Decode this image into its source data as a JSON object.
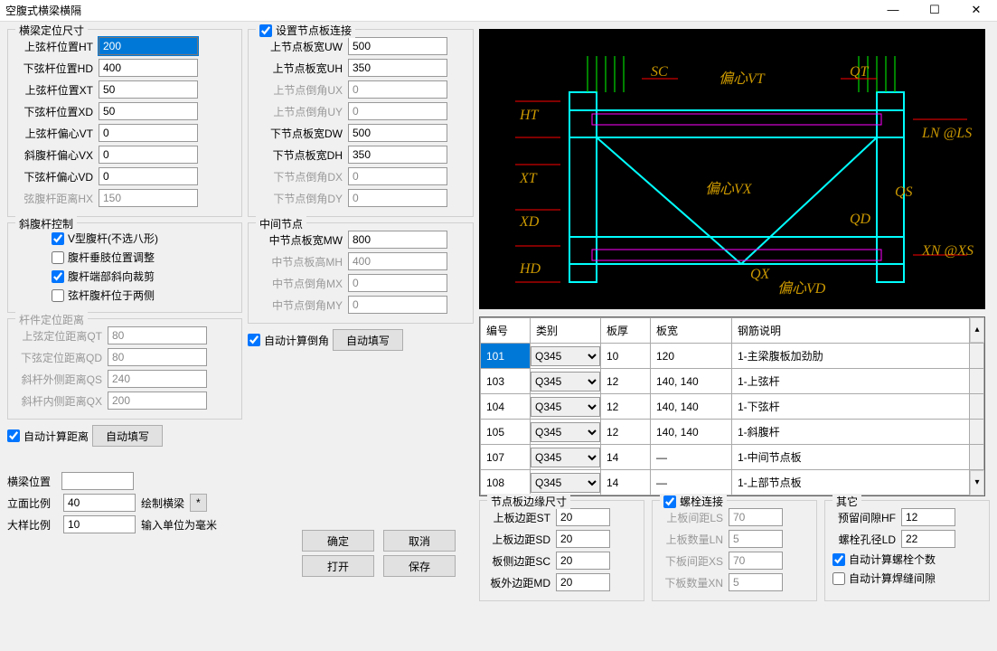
{
  "window": {
    "title": "空腹式横梁横隔"
  },
  "pos": {
    "title": "横梁定位尺寸",
    "ht_label": "上弦杆位置HT",
    "ht": "200",
    "hd_label": "下弦杆位置HD",
    "hd": "400",
    "xt_label": "上弦杆位置XT",
    "xt": "50",
    "xd_label": "下弦杆位置XD",
    "xd": "50",
    "vt_label": "上弦杆偏心VT",
    "vt": "0",
    "vx_label": "斜腹杆偏心VX",
    "vx": "0",
    "vd_label": "下弦杆偏心VD",
    "vd": "0",
    "hx_label": "弦腹杆距离HX",
    "hx": "150"
  },
  "diag": {
    "title": "斜腹杆控制",
    "vshape": "V型腹杆(不选八形)",
    "vertical": "腹杆垂肢位置调整",
    "endcut": "腹杆端部斜向裁剪",
    "bothside": "弦杆腹杆位于两侧"
  },
  "memdist": {
    "title": "杆件定位距离",
    "qt_label": "上弦定位距离QT",
    "qt": "80",
    "qd_label": "下弦定位距离QD",
    "qd": "80",
    "qs_label": "斜杆外侧距离QS",
    "qs": "240",
    "qx_label": "斜杆内侧距离QX",
    "qx": "200"
  },
  "autodist": {
    "chk": "自动计算距离",
    "btn": "自动填写"
  },
  "beam": {
    "pos_label": "横梁位置",
    "pos": "",
    "elev_label": "立面比例",
    "elev": "40",
    "detail_label": "大样比例",
    "detail": "10",
    "draw_label": "绘制横梁",
    "star": "*",
    "unit": "输入单位为毫米"
  },
  "nodeplate": {
    "chk": "设置节点板连接",
    "uw_label": "上节点板宽UW",
    "uw": "500",
    "uh_label": "上节点板宽UH",
    "uh": "350",
    "ux_label": "上节点倒角UX",
    "ux": "0",
    "uy_label": "上节点倒角UY",
    "uy": "0",
    "dw_label": "下节点板宽DW",
    "dw": "500",
    "dh_label": "下节点板宽DH",
    "dh": "350",
    "dx_label": "下节点倒角DX",
    "dx": "0",
    "dy_label": "下节点倒角DY",
    "dy": "0"
  },
  "midnode": {
    "title": "中间节点",
    "mw_label": "中节点板宽MW",
    "mw": "800",
    "mh_label": "中节点板高MH",
    "mh": "400",
    "mx_label": "中节点倒角MX",
    "mx": "0",
    "my_label": "中节点倒角MY",
    "my": "0"
  },
  "autochamfer": {
    "chk": "自动计算倒角",
    "btn": "自动填写"
  },
  "buttons": {
    "ok": "确定",
    "cancel": "取消",
    "open": "打开",
    "save": "保存"
  },
  "table": {
    "h_id": "编号",
    "h_type": "类别",
    "h_thick": "板厚",
    "h_width": "板宽",
    "h_rebar": "钢筋说明",
    "rows": [
      {
        "id": "101",
        "type": "Q345",
        "thick": "10",
        "width": "120",
        "rebar": "1-主梁腹板加劲肋",
        "sel": true
      },
      {
        "id": "103",
        "type": "Q345",
        "thick": "12",
        "width": "140, 140",
        "rebar": "1-上弦杆"
      },
      {
        "id": "104",
        "type": "Q345",
        "thick": "12",
        "width": "140, 140",
        "rebar": "1-下弦杆"
      },
      {
        "id": "105",
        "type": "Q345",
        "thick": "12",
        "width": "140, 140",
        "rebar": "1-斜腹杆"
      },
      {
        "id": "107",
        "type": "Q345",
        "thick": "14",
        "width": "—",
        "rebar": "1-中间节点板"
      },
      {
        "id": "108",
        "type": "Q345",
        "thick": "14",
        "width": "—",
        "rebar": "1-上部节点板"
      }
    ]
  },
  "edge": {
    "title": "节点板边缘尺寸",
    "st_label": "上板边距ST",
    "st": "20",
    "sd_label": "上板边距SD",
    "sd": "20",
    "sc_label": "板侧边距SC",
    "sc": "20",
    "md_label": "板外边距MD",
    "md": "20"
  },
  "bolt": {
    "chk": "螺栓连接",
    "ls_label": "上板间距LS",
    "ls": "70",
    "ln_label": "上板数量LN",
    "ln": "5",
    "xs_label": "下板间距XS",
    "xs": "70",
    "xn_label": "下板数量XN",
    "xn": "5"
  },
  "other": {
    "title": "其它",
    "hf_label": "预留间隙HF",
    "hf": "12",
    "ld_label": "螺栓孔径LD",
    "ld": "22",
    "autobolt": "自动计算螺栓个数",
    "autoweld": "自动计算焊缝间隙"
  },
  "diagram_labels": {
    "sc": "SC",
    "vt": "偏心VT",
    "qt": "QT",
    "ht": "HT",
    "xt": "XT",
    "vx": "偏心VX",
    "xd": "XD",
    "hd": "HD",
    "qd": "QD",
    "vd": "偏心VD",
    "ln": "LN @LS",
    "xn": "XN @XS",
    "qx": "QX",
    "qs": "QS"
  }
}
